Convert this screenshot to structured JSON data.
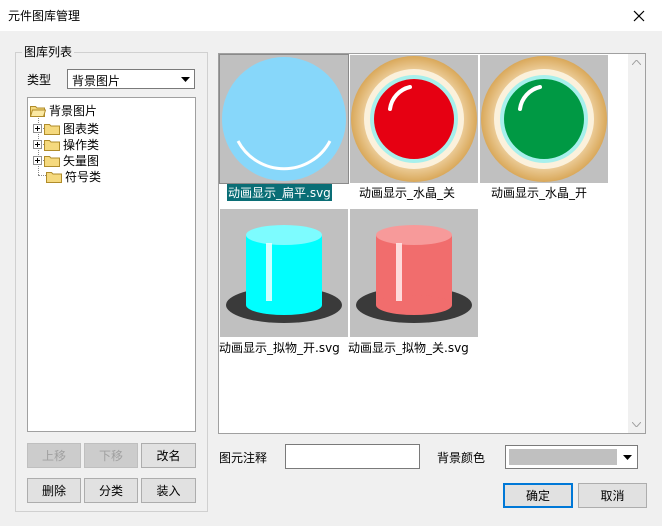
{
  "window": {
    "title": "元件图库管理"
  },
  "library": {
    "group_title": "图库列表",
    "type_label": "类型",
    "type_value": "背景图片",
    "tree": {
      "root": "背景图片",
      "children": [
        "图表类",
        "操作类",
        "矢量图",
        "符号类"
      ]
    },
    "buttons": {
      "move_up": "上移",
      "move_down": "下移",
      "rename": "改名",
      "delete": "删除",
      "categorize": "分类",
      "load": "装入"
    }
  },
  "gallery": {
    "items": [
      {
        "caption": "动画显示_扁平.svg",
        "icon": "flat-light-blue-indicator",
        "selected": true
      },
      {
        "caption": "动画显示_水晶_关",
        "icon": "crystal-red-indicator",
        "selected": false
      },
      {
        "caption": "动画显示_水晶_开",
        "icon": "crystal-green-indicator",
        "selected": false
      },
      {
        "caption": "动画显示_拟物_开.svg",
        "icon": "cylinder-cyan-light",
        "selected": false
      },
      {
        "caption": "动画显示_拟物_关.svg",
        "icon": "cylinder-red-light",
        "selected": false
      }
    ]
  },
  "properties": {
    "note_label": "图元注释",
    "note_value": "",
    "bg_color_label": "背景颜色",
    "bg_color_value": "#c0c0c0"
  },
  "actions": {
    "ok": "确定",
    "cancel": "取消"
  },
  "colors": {
    "selection": "#0a6e76",
    "thumb_background": "#c0c0c0",
    "flat_fill": "#87d7fa",
    "crystal_red": "#e60012",
    "crystal_green": "#009944",
    "cylinder_cyan": "#00ffff",
    "cylinder_red": "#f16d6d"
  }
}
